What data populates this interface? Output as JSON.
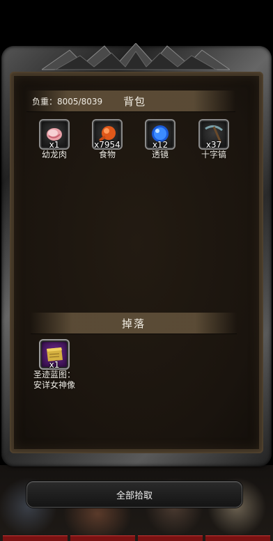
{
  "bag": {
    "weight_label": "负重：8005/8039",
    "title": "背包",
    "items": [
      {
        "name": "幼龙肉",
        "count": "x1",
        "icon": "dragon-meat-icon"
      },
      {
        "name": "食物",
        "count": "x7954",
        "icon": "food-icon"
      },
      {
        "name": "透镜",
        "count": "x12",
        "icon": "lens-icon"
      },
      {
        "name": "十字镐",
        "count": "x37",
        "icon": "pickaxe-icon"
      }
    ]
  },
  "drops": {
    "title": "掉落",
    "items": [
      {
        "name_line1": "圣迹蓝图：",
        "name_line2": "安详女神像",
        "count": "x1",
        "icon": "blueprint-scroll-icon"
      }
    ]
  },
  "actions": {
    "pick_all_label": "全部拾取"
  },
  "colors": {
    "panel": "#1a140e",
    "header_band": "#6e5c42",
    "drop_slot": "#5a1f7a",
    "status_bar": "#7a1212"
  }
}
